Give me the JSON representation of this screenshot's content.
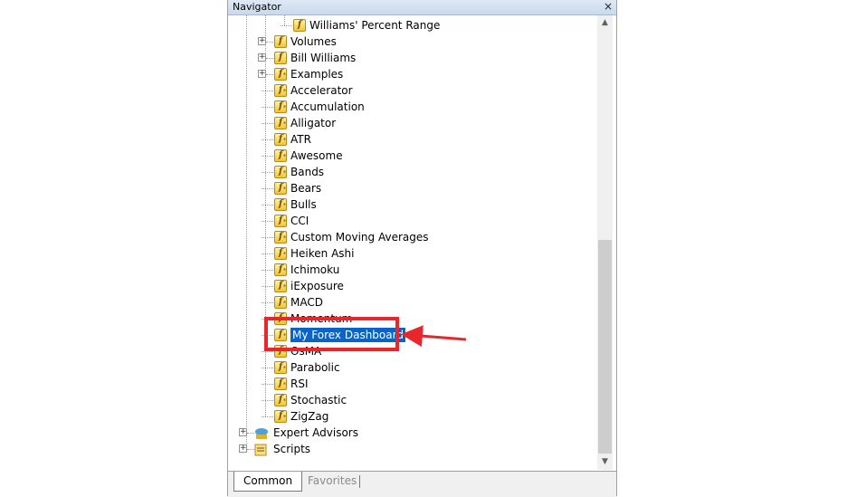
{
  "panel": {
    "title": "Navigator",
    "close_symbol": "×"
  },
  "tree": {
    "items": [
      {
        "label": "Williams' Percent Range",
        "icon": "indicator-icon",
        "expander": false,
        "level": 3,
        "selected": false
      },
      {
        "label": "Volumes",
        "icon": "indicator-folder-icon",
        "expander": true,
        "level": 2,
        "selected": false
      },
      {
        "label": "Bill Williams",
        "icon": "indicator-folder-icon",
        "expander": true,
        "level": 2,
        "selected": false
      },
      {
        "label": "Examples",
        "icon": "custom-indicator-folder-icon",
        "expander": true,
        "level": 2,
        "selected": false
      },
      {
        "label": "Accelerator",
        "icon": "custom-indicator-icon",
        "expander": false,
        "level": 2,
        "selected": false
      },
      {
        "label": "Accumulation",
        "icon": "custom-indicator-icon",
        "expander": false,
        "level": 2,
        "selected": false
      },
      {
        "label": "Alligator",
        "icon": "custom-indicator-icon",
        "expander": false,
        "level": 2,
        "selected": false
      },
      {
        "label": "ATR",
        "icon": "custom-indicator-icon",
        "expander": false,
        "level": 2,
        "selected": false
      },
      {
        "label": "Awesome",
        "icon": "custom-indicator-icon",
        "expander": false,
        "level": 2,
        "selected": false
      },
      {
        "label": "Bands",
        "icon": "custom-indicator-icon",
        "expander": false,
        "level": 2,
        "selected": false
      },
      {
        "label": "Bears",
        "icon": "custom-indicator-icon",
        "expander": false,
        "level": 2,
        "selected": false
      },
      {
        "label": "Bulls",
        "icon": "custom-indicator-icon",
        "expander": false,
        "level": 2,
        "selected": false
      },
      {
        "label": "CCI",
        "icon": "custom-indicator-icon",
        "expander": false,
        "level": 2,
        "selected": false
      },
      {
        "label": "Custom Moving Averages",
        "icon": "custom-indicator-icon",
        "expander": false,
        "level": 2,
        "selected": false
      },
      {
        "label": "Heiken Ashi",
        "icon": "custom-indicator-icon",
        "expander": false,
        "level": 2,
        "selected": false
      },
      {
        "label": "Ichimoku",
        "icon": "custom-indicator-icon",
        "expander": false,
        "level": 2,
        "selected": false
      },
      {
        "label": "iExposure",
        "icon": "custom-indicator-icon",
        "expander": false,
        "level": 2,
        "selected": false
      },
      {
        "label": "MACD",
        "icon": "custom-indicator-icon",
        "expander": false,
        "level": 2,
        "selected": false
      },
      {
        "label": "Momentum",
        "icon": "custom-indicator-icon",
        "expander": false,
        "level": 2,
        "selected": false
      },
      {
        "label": "My Forex Dashboard",
        "icon": "custom-indicator-icon",
        "expander": false,
        "level": 2,
        "selected": true
      },
      {
        "label": "OsMA",
        "icon": "custom-indicator-icon",
        "expander": false,
        "level": 2,
        "selected": false
      },
      {
        "label": "Parabolic",
        "icon": "custom-indicator-icon",
        "expander": false,
        "level": 2,
        "selected": false
      },
      {
        "label": "RSI",
        "icon": "custom-indicator-icon",
        "expander": false,
        "level": 2,
        "selected": false
      },
      {
        "label": "Stochastic",
        "icon": "custom-indicator-icon",
        "expander": false,
        "level": 2,
        "selected": false
      },
      {
        "label": "ZigZag",
        "icon": "custom-indicator-icon",
        "expander": false,
        "level": 2,
        "selected": false
      },
      {
        "label": "Expert Advisors",
        "icon": "expert-advisors-icon",
        "expander": true,
        "level": 1,
        "selected": false
      },
      {
        "label": "Scripts",
        "icon": "scripts-icon",
        "expander": true,
        "level": 1,
        "selected": false
      }
    ]
  },
  "scrollbar": {
    "up_symbol": "▲",
    "down_symbol": "▼"
  },
  "tabs": {
    "common": "Common",
    "favorites": "Favorites"
  },
  "icon_glyph": "f",
  "colors": {
    "selection": "#0a64c8",
    "highlight_box": "#e8262b"
  }
}
